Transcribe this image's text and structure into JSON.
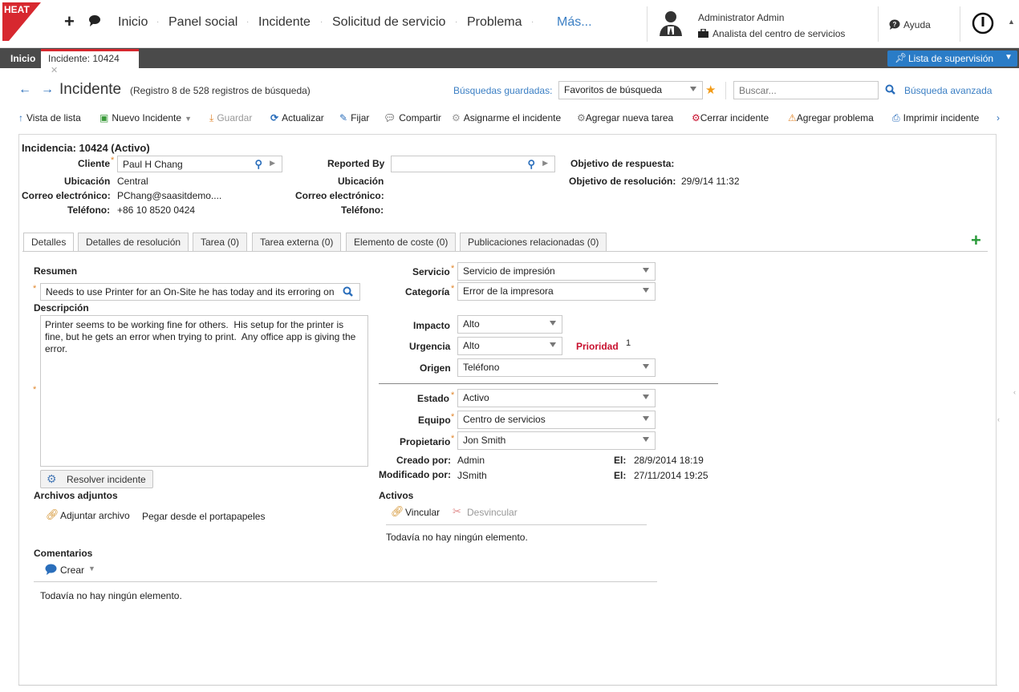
{
  "brand": {
    "logo_text": "HEAT"
  },
  "nav": {
    "items": [
      "Inicio",
      "Panel social",
      "Incidente",
      "Solicitud de servicio",
      "Problema"
    ],
    "more": "Más..."
  },
  "user": {
    "name": "Administrator Admin",
    "role": "Analista del centro de servicios"
  },
  "help": "Ayuda",
  "tabs": {
    "home": "Inicio",
    "incident": "Incidente: 10424"
  },
  "watchlist": "Lista de supervisión",
  "header": {
    "title": "Incidente",
    "record_info": "(Registro 8 de 528 registros de búsqueda)",
    "saved_label": "Búsquedas guardadas:",
    "saved_value": "Favoritos de búsqueda",
    "search_placeholder": "Buscar...",
    "advanced": "Búsqueda avanzada"
  },
  "toolbar": {
    "list_view": "Vista de lista",
    "new_incident": "Nuevo Incidente",
    "save": "Guardar",
    "refresh": "Actualizar",
    "pin": "Fijar",
    "share": "Compartir",
    "assign": "Asignarme el incidente",
    "add_task": "Agregar nueva tarea",
    "close": "Cerrar incidente",
    "add_problem": "Agregar problema",
    "print": "Imprimir incidente"
  },
  "record": {
    "title": "Incidencia: 10424 (Activo)",
    "customer_label": "Cliente",
    "customer": "Paul H Chang",
    "location_label": "Ubicación",
    "location": "Central",
    "email_label": "Correo electrónico:",
    "email": "PChang@saasitdemo....",
    "phone_label": "Teléfono:",
    "phone": "+86 10 8520 0424",
    "reported_label": "Reported By",
    "r_location_label": "Ubicación",
    "r_email_label": "Correo electrónico:",
    "r_phone_label": "Teléfono:",
    "response_label": "Objetivo de respuesta:",
    "resolution_label": "Objetivo de resolución:",
    "resolution": "29/9/14 11:32"
  },
  "detail_tabs": [
    "Detalles",
    "Detalles de resolución",
    "Tarea (0)",
    "Tarea externa (0)",
    "Elemento de coste (0)",
    "Publicaciones relacionadas (0)"
  ],
  "details": {
    "summary_label": "Resumen",
    "summary": "Needs to use Printer for an On-Site he has today and its erroring on",
    "description_label": "Descripción",
    "description": "Printer seems to be working fine for others.  His setup for the printer is fine, but he gets an error when trying to print.  Any office app is giving the error.",
    "resolve_button": "Resolver incidente",
    "attachments_label": "Archivos adjuntos",
    "attach": "Adjuntar archivo",
    "paste": "Pegar desde el portapapeles",
    "comments_label": "Comentarios",
    "create": "Crear",
    "comments_empty": "Todavía no hay ningún elemento.",
    "service_label": "Servicio",
    "service": "Servicio de impresión",
    "category_label": "Categoría",
    "category": "Error de la impresora",
    "impact_label": "Impacto",
    "impact": "Alto",
    "urgency_label": "Urgencia",
    "urgency": "Alto",
    "priority_label": "Prioridad",
    "priority": "1",
    "source_label": "Origen",
    "source": "Teléfono",
    "status_label": "Estado",
    "status": "Activo",
    "team_label": "Equipo",
    "team": "Centro de servicios",
    "owner_label": "Propietario",
    "owner": "Jon Smith",
    "created_label": "Creado por:",
    "created_by": "Admin",
    "created_on_label": "El:",
    "created_on": "28/9/2014 18:19",
    "modified_label": "Modificado por:",
    "modified_by": "JSmith",
    "modified_on_label": "El:",
    "modified_on": "27/11/2014 19:25",
    "assets_label": "Activos",
    "link": "Vincular",
    "unlink": "Desvincular",
    "assets_empty": "Todavía no hay ningún elemento."
  },
  "colors": {
    "accent": "#2a7cc7",
    "brand": "#d7282f",
    "priority": "#c8102e",
    "required": "#e0862c"
  }
}
